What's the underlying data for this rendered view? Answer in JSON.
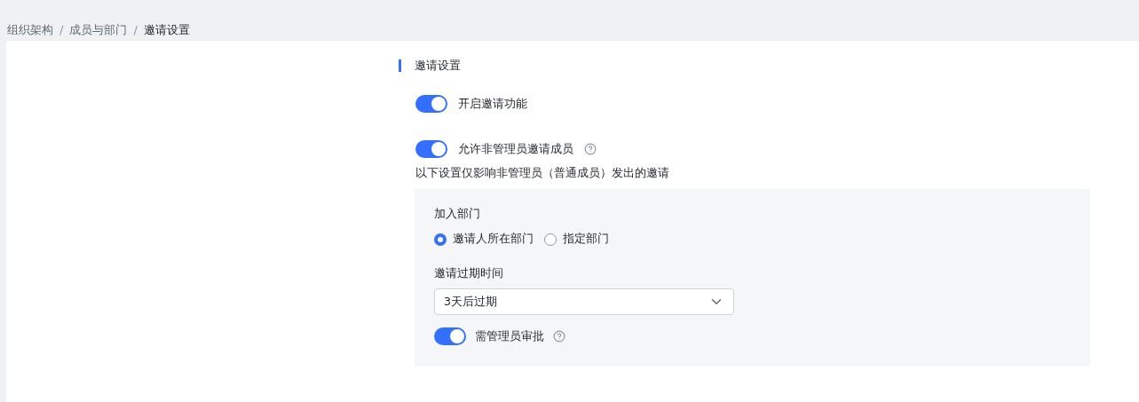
{
  "breadcrumb_separator": "/",
  "breadcrumb": [
    {
      "label": "组织架构",
      "selected": false
    },
    {
      "label": "成员与部门",
      "selected": false
    },
    {
      "label": "邀请设置",
      "selected": true
    }
  ],
  "section_title": "邀请设置",
  "switches": [
    {
      "label": "开启邀请功能",
      "on": true,
      "help": false
    },
    {
      "label": "允许非管理员邀请成员",
      "on": true,
      "help": true
    }
  ],
  "note": "以下设置仅影响非管理员（普通成员）发出的邀请",
  "member_settings": {
    "department_label": "加入部门",
    "department_options": [
      {
        "label": "邀请人所在部门",
        "selected": true
      },
      {
        "label": "指定部门",
        "selected": false
      }
    ],
    "expiry_label": "邀请过期时间",
    "expiry_value": "3天后过期",
    "approval": {
      "label": "需管理员审批",
      "on": true,
      "help": true
    }
  }
}
